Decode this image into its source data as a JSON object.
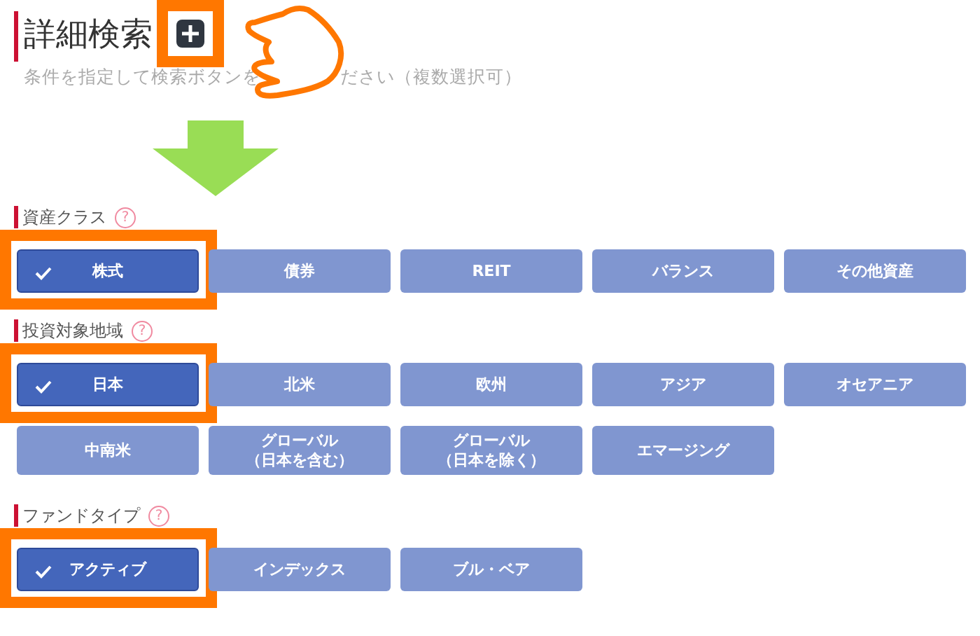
{
  "title": "詳細検索",
  "subtitle": [
    "条件を指定して検索ボタンを",
    "ださい（複数選択可）"
  ],
  "sections": [
    {
      "label": "資産クラス",
      "help": "?",
      "options": [
        {
          "label": "株式",
          "selected": true
        },
        {
          "label": "債券",
          "selected": false
        },
        {
          "label": "REIT",
          "selected": false
        },
        {
          "label": "バランス",
          "selected": false
        },
        {
          "label": "その他資産",
          "selected": false
        }
      ]
    },
    {
      "label": "投資対象地域",
      "help": "?",
      "options": [
        {
          "label": "日本",
          "selected": true
        },
        {
          "label": "北米",
          "selected": false
        },
        {
          "label": "欧州",
          "selected": false
        },
        {
          "label": "アジア",
          "selected": false
        },
        {
          "label": "オセアニア",
          "selected": false
        },
        {
          "label": "中南米",
          "selected": false
        },
        {
          "lines": [
            "グローバル",
            "（日本を含む）"
          ],
          "selected": false
        },
        {
          "lines": [
            "グローバル",
            "（日本を除く）"
          ],
          "selected": false
        },
        {
          "label": "エマージング",
          "selected": false
        }
      ]
    },
    {
      "label": "ファンドタイプ",
      "help": "?",
      "options": [
        {
          "label": "アクティブ",
          "selected": true
        },
        {
          "label": "インデックス",
          "selected": false
        },
        {
          "label": "ブル・ベア",
          "selected": false
        }
      ]
    }
  ]
}
